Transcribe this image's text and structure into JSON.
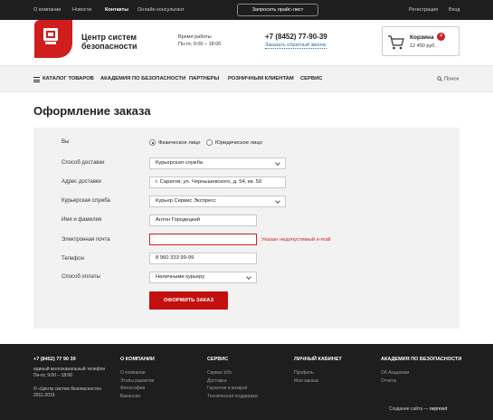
{
  "colors": {
    "accent": "#d01e1e",
    "button": "#c40f0f",
    "topbar": "#1e1e1e",
    "link": "#1d6fa5"
  },
  "topbar": {
    "links": [
      "О компании",
      "Новости",
      "Контакты",
      "Онлайн консультант"
    ],
    "active": "Контакты",
    "price_button": "Запросить прайс-лист",
    "register": "Регистрация",
    "login": "Вход"
  },
  "header": {
    "logo_line1": "Центр систем",
    "logo_line2": "безопасности",
    "hours_line1": "Время работы",
    "hours_line2": "Пн-пт, 9:00 – 18:00",
    "phone": "+7 (8452) 77-90-39",
    "callback": "Заказать обратный звонок",
    "cart_title": "Корзина",
    "cart_count": "4",
    "cart_sum": "12 450 руб.",
    "cart_icon": "cart-icon"
  },
  "nav": {
    "items": [
      "КАТАЛОГ ТОВАРОВ",
      "АКАДЕМИЯ ПО БЕЗОПАСНОСТИ",
      "ПАРТНЕРЫ",
      "РОЗНИЧНЫМ КЛИЕНТАМ",
      "СЕРВИС"
    ],
    "search": "Поиск",
    "search_icon": "search-icon",
    "menu_icon": "burger-icon"
  },
  "page_title": "Оформление заказа",
  "form": {
    "you_label": "Вы",
    "radio_individual": "Физическое лицо",
    "radio_legal": "Юридическое лицо",
    "selected_radio": "Физическое лицо",
    "delivery_label": "Способ доставки",
    "delivery_value": "Курьерская служба",
    "address_label": "Адрес доставки",
    "address_value": "г. Саратов, ул. Чернышевского, д. 54, кв. 50",
    "courier_label": "Курьерская служба",
    "courier_value": "Курьер Сервис Экспресс",
    "name_label": "Имя и фамилия",
    "name_value": "Антон Городецкий",
    "email_label": "Электронная почта",
    "email_value": "",
    "email_error": "Указан недопустимый e-mail",
    "phone_label": "Телефон",
    "phone_value": "8 960 333 99-99",
    "payment_label": "Способ оплаты",
    "payment_value": "Наличными курьеру",
    "submit": "ОФОРМИТЬ ЗАКАЗ"
  },
  "footer": {
    "phone": "+7 (8452) 77 90 39",
    "phone_desc1": "единый многоканальный телефон",
    "phone_desc2": "Пн-пт, 9:00 – 18:00",
    "copyright1": "© «Центр систем безопасности»",
    "copyright2": "2011-2015",
    "columns": [
      {
        "title": "О КОМПАНИИ",
        "items": [
          "О компании",
          "Этапы развития",
          "Философия",
          "Вакансии"
        ]
      },
      {
        "title": "СЕРВИС",
        "items": [
          "Сервис b2b",
          "Доставка",
          "Гарантия и возврат",
          "Техническая поддержка"
        ]
      },
      {
        "title": "ЛИЧНЫЙ КАБИНЕТ",
        "items": [
          "Профиль",
          "Мои заказы"
        ]
      },
      {
        "title": "АКАДЕМИЯ ПО БЕЗОПАСНОСТИ",
        "items": [
          "Об Академии",
          "Отчеты"
        ]
      }
    ],
    "credit_prefix": "Создание сайта —",
    "credit_name": "nepreset"
  }
}
